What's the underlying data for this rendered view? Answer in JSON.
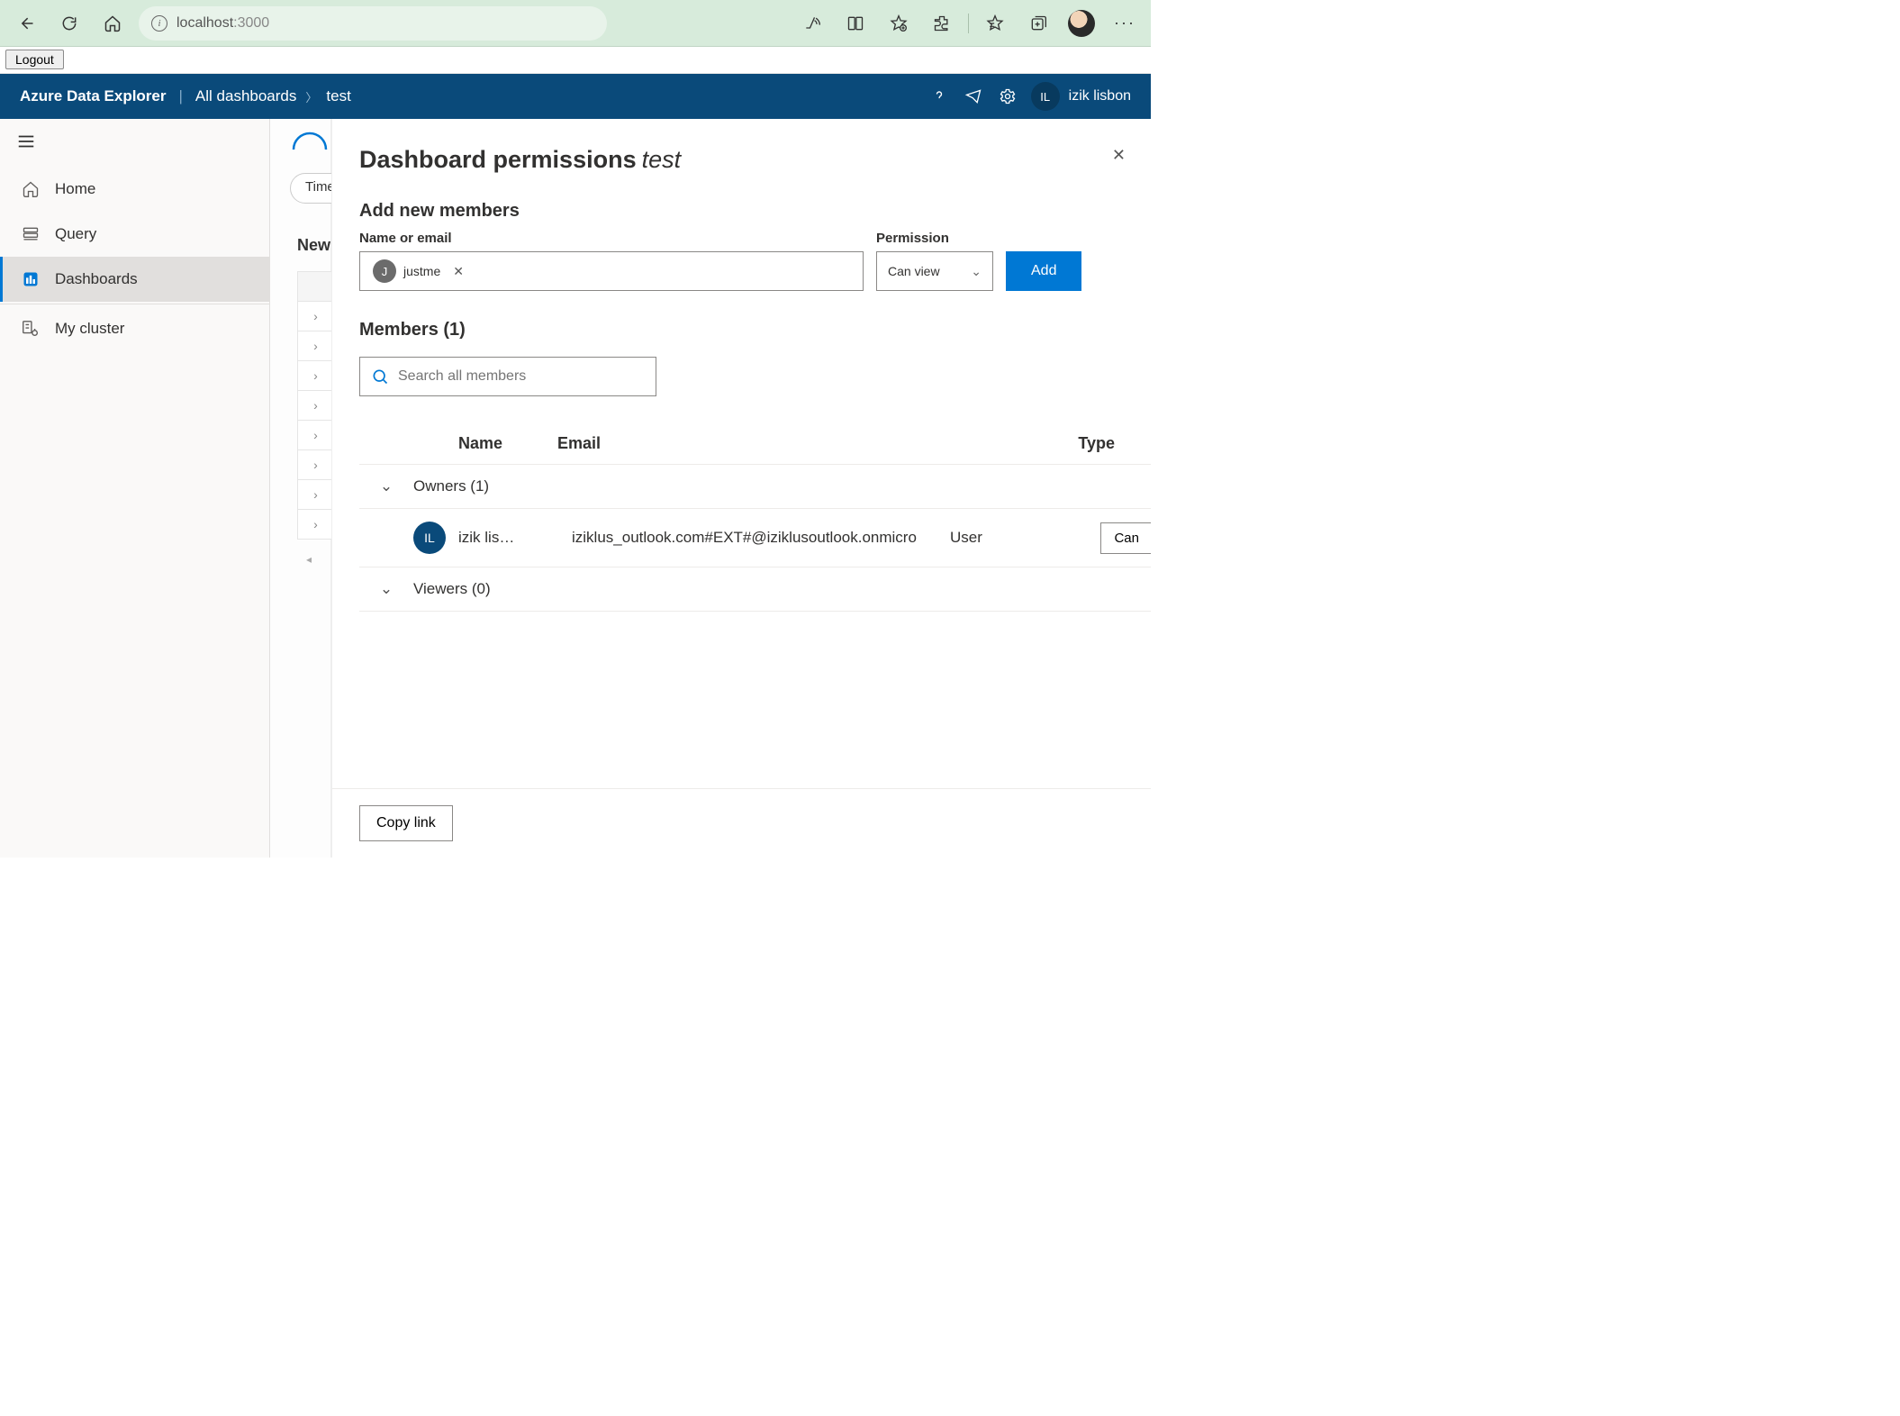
{
  "browser": {
    "url_host": "localhost",
    "url_port": ":3000"
  },
  "logout": {
    "label": "Logout"
  },
  "header": {
    "brand": "Azure Data Explorer",
    "breadcrumb_root": "All dashboards",
    "breadcrumb_current": "test",
    "avatar_initials": "IL",
    "user_name": "izik lisbon"
  },
  "sidebar": {
    "items": [
      {
        "label": "Home"
      },
      {
        "label": "Query"
      },
      {
        "label": "Dashboards"
      },
      {
        "label": "My cluster"
      }
    ]
  },
  "background": {
    "pill": "Time",
    "new_label": "New"
  },
  "panel": {
    "title": "Dashboard permissions",
    "title_em": "test",
    "add_section": "Add new members",
    "name_label": "Name or email",
    "chip": {
      "initial": "J",
      "name": "justme"
    },
    "perm_label": "Permission",
    "perm_value": "Can view",
    "add_btn": "Add",
    "members_head": "Members (1)",
    "search_placeholder": "Search all members",
    "columns": {
      "name": "Name",
      "email": "Email",
      "type": "Type"
    },
    "groups": {
      "owners": "Owners (1)",
      "viewers": "Viewers (0)"
    },
    "owner_row": {
      "initials": "IL",
      "name": "izik lis…",
      "email": "iziklus_outlook.com#EXT#@iziklusoutlook.onmicro",
      "type": "User",
      "perm": "Can"
    },
    "copy_link": "Copy link"
  }
}
